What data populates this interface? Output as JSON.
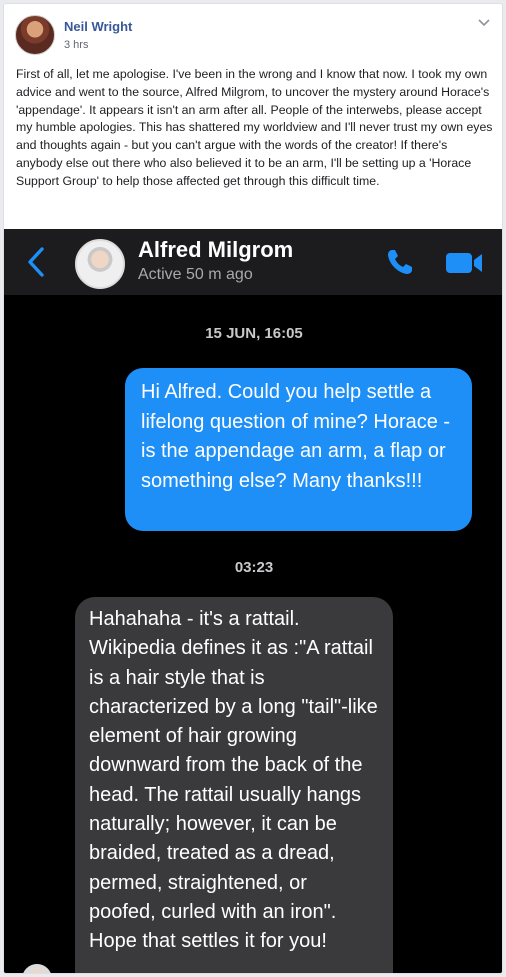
{
  "post": {
    "author": "Neil Wright",
    "time": "3 hrs",
    "text": "First of all, let me apologise. I've been in the wrong and I know that now. I took my own advice and went to the source, Alfred Milgrom, to uncover the mystery around Horace's 'appendage'. It appears it isn't an arm after all. People of the interwebs, please accept my humble apologies. This has shattered my worldview and I'll never trust my own eyes and thoughts again - but you can't argue with the words of the creator! If there's anybody else out there who also believed it to be an arm, I'll be setting up a 'Horace Support Group' to help those affected get through this difficult time."
  },
  "chat": {
    "contact_name": "Alfred Milgrom",
    "contact_status": "Active 50 m ago",
    "timestamp_1": "15 JUN, 16:05",
    "message_out": "Hi Alfred. Could you help settle a lifelong question of mine? Horace - is the appendage an arm, a flap or something else? Many thanks!!!",
    "timestamp_2": "03:23",
    "message_in": "Hahahaha - it's a rattail. Wikipedia defines it as :\"A rattail is a hair style that is characterized by a long \"tail\"-like element of hair growing downward from the back of the head. The rattail usually hangs naturally; however, it can be braided, treated as a dread, permed, straightened, or poofed, curled with an iron\". Hope that settles it for you!"
  },
  "colors": {
    "link_blue": "#385898",
    "messenger_blue": "#1e8ff7",
    "bubble_gray": "#3a3a3c",
    "chat_bg": "#000000"
  },
  "icons": [
    "chevron-down-icon",
    "back-arrow-icon",
    "phone-call-icon",
    "video-call-icon"
  ]
}
